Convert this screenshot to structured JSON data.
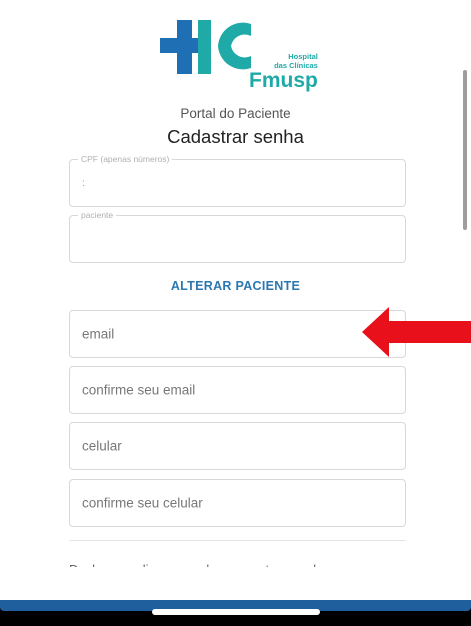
{
  "logo": {
    "line1": "Hospital",
    "line2": "das Clínicas",
    "line3": "Fmusp",
    "colors": {
      "blue": "#1f6fb5",
      "teal": "#1faaa8"
    }
  },
  "header": {
    "portal_title": "Portal do Paciente",
    "page_title": "Cadastrar senha"
  },
  "form": {
    "cpf": {
      "legend": "CPF (apenas números)",
      "value": ":"
    },
    "paciente": {
      "legend": "paciente",
      "value": ""
    },
    "alterar_label": "ALTERAR PACIENTE",
    "email_placeholder": "email",
    "confirm_email_placeholder": "confirme seu email",
    "celular_placeholder": "celular",
    "confirm_celular_placeholder": "confirme seu celular"
  },
  "footer": {
    "partial_text": "Declaro que li e concordo com os termos de uso"
  },
  "annotation": {
    "arrow_color": "#e8101a"
  },
  "colors": {
    "link": "#2b78b0",
    "system_bar": "#1f5f9e"
  }
}
